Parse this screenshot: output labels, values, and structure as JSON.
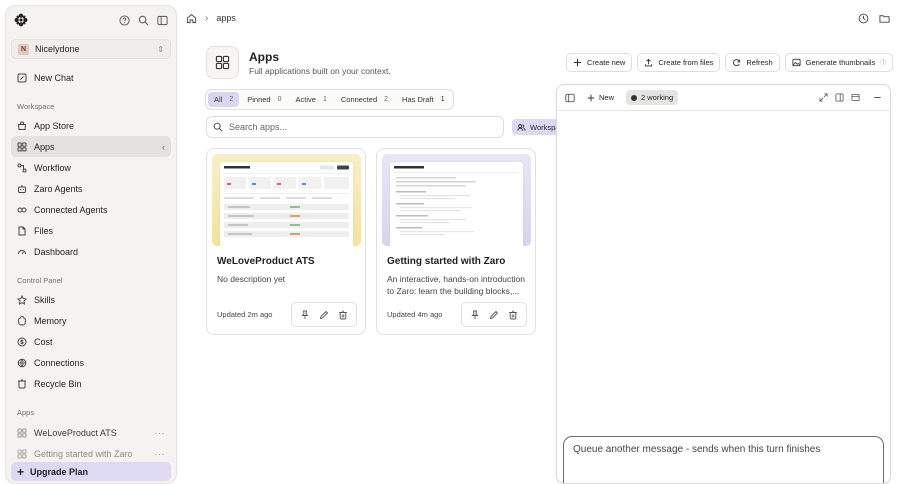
{
  "sidebar": {
    "workspace_badge": "N",
    "workspace_name": "Nicelydone",
    "new_chat": "New Chat",
    "workspace_section": "Workspace",
    "workspace_items": [
      {
        "label": "App Store",
        "icon": "store-icon"
      },
      {
        "label": "Apps",
        "icon": "apps-icon"
      },
      {
        "label": "Workflow",
        "icon": "workflow-icon"
      },
      {
        "label": "Zaro Agents",
        "icon": "agents-icon"
      },
      {
        "label": "Connected Agents",
        "icon": "connected-agents-icon"
      },
      {
        "label": "Files",
        "icon": "file-icon"
      },
      {
        "label": "Dashboard",
        "icon": "dashboard-icon"
      }
    ],
    "control_section": "Control Panel",
    "control_items": [
      {
        "label": "Skills",
        "icon": "skills-icon"
      },
      {
        "label": "Memory",
        "icon": "memory-icon"
      },
      {
        "label": "Cost",
        "icon": "cost-icon"
      },
      {
        "label": "Connections",
        "icon": "connections-icon"
      },
      {
        "label": "Recycle Bin",
        "icon": "trash-icon"
      }
    ],
    "apps_section": "Apps",
    "app_items": [
      "WeLoveProduct ATS",
      "Getting started with Zaro"
    ],
    "upgrade": "Upgrade Plan"
  },
  "topbar": {
    "crumb": "apps"
  },
  "header": {
    "title": "Apps",
    "subtitle": "Full applications built on your context.",
    "actions": {
      "create_new": "Create new",
      "create_from_files": "Create from files",
      "refresh": "Refresh",
      "generate_thumbnails": "Generate thumbnails"
    }
  },
  "filters": [
    {
      "label": "All",
      "count": "2"
    },
    {
      "label": "Pinned",
      "count": "0"
    },
    {
      "label": "Active",
      "count": "1"
    },
    {
      "label": "Connected",
      "count": "2"
    },
    {
      "label": "Has Draft",
      "count": "1"
    }
  ],
  "search": {
    "placeholder": "Search apps...",
    "scope": "Workspace"
  },
  "cards": [
    {
      "title": "WeLoveProduct ATS",
      "description": "No description yet",
      "updated": "Updated 2m ago"
    },
    {
      "title": "Getting started with Zaro",
      "description": "An interactive, hands-on introduction to Zaro: learn the building blocks,...",
      "updated": "Updated 4m ago"
    }
  ],
  "chat_panel": {
    "new_label": "New",
    "working_label": "2 working",
    "composer_placeholder": "Queue another message - sends when this turn finishes"
  },
  "colors": {
    "accent": "#d9d6f1",
    "sidebar_bg": "#f4f3f1",
    "upgrade_bg": "#ddd9f3"
  }
}
